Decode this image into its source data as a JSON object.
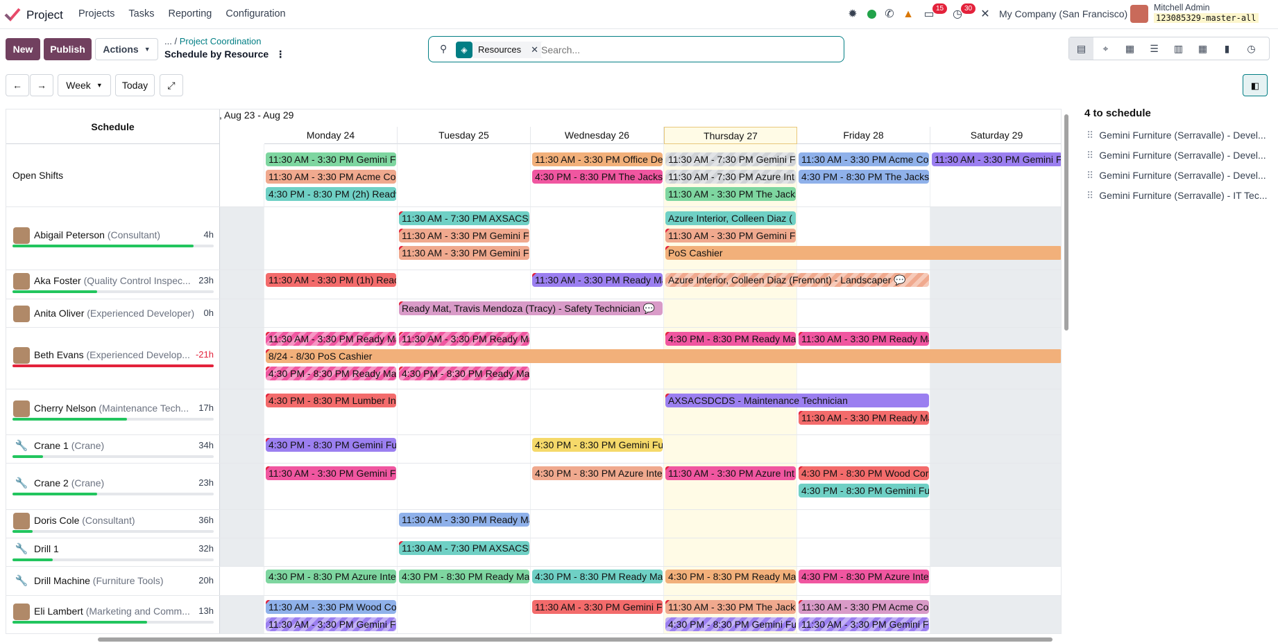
{
  "app": {
    "name": "Project"
  },
  "nav": [
    "Projects",
    "Tasks",
    "Reporting",
    "Configuration"
  ],
  "systray": {
    "messages_badge": "15",
    "activity_badge": "30",
    "company": "My Company (San Francisco)",
    "user": "Mitchell Admin",
    "db": "123085329-master-all"
  },
  "actions": {
    "new": "New",
    "publish": "Publish",
    "actions": "Actions"
  },
  "breadcrumb": {
    "ellipsis": "...",
    "parent": "Project Coordination",
    "current": "Schedule by Resource"
  },
  "search": {
    "facet": "Resources",
    "placeholder": "Search..."
  },
  "controls": {
    "scale": "Week",
    "today": "Today"
  },
  "range": "Aug 23 - Aug 29",
  "columns": {
    "schedule": "Schedule",
    "days": [
      "Monday 24",
      "Tuesday 25",
      "Wednesday 26",
      "Thursday 27",
      "Friday 28",
      "Saturday 29"
    ]
  },
  "rows": [
    {
      "name": "Open Shifts",
      "role": "",
      "hours": "",
      "progress": null
    },
    {
      "name": "Abigail Peterson",
      "role": "(Consultant)",
      "hours": "4h",
      "progress": 0.9
    },
    {
      "name": "Aka Foster",
      "role": "(Quality Control Inspec...",
      "hours": "23h",
      "progress": 0.42
    },
    {
      "name": "Anita Oliver",
      "role": "(Experienced Developer)",
      "hours": "0h",
      "progress": null
    },
    {
      "name": "Beth Evans",
      "role": "(Experienced Develop...",
      "hours": "-21h",
      "progress": 1.0
    },
    {
      "name": "Cherry Nelson",
      "role": "(Maintenance Tech...",
      "hours": "17h",
      "progress": 0.57
    },
    {
      "name": "Crane 1",
      "role": "(Crane)",
      "hours": "34h",
      "progress": 0.15
    },
    {
      "name": "Crane 2",
      "role": "(Crane)",
      "hours": "23h",
      "progress": 0.42
    },
    {
      "name": "Doris Cole",
      "role": "(Consultant)",
      "hours": "36h",
      "progress": 0.1
    },
    {
      "name": "Drill 1",
      "role": "",
      "hours": "32h",
      "progress": 0.2
    },
    {
      "name": "Drill Machine",
      "role": "(Furniture Tools)",
      "hours": "20h",
      "progress": null
    },
    {
      "name": "Eli Lambert",
      "role": "(Marketing and Comm...",
      "hours": "13h",
      "progress": 0.67
    }
  ],
  "shifts": [
    {
      "row": 0,
      "line": 0,
      "start": 0,
      "span": 1,
      "text": "11:30 AM - 3:30 PM Gemini Fu",
      "color": "#7ed6a0"
    },
    {
      "row": 0,
      "line": 1,
      "start": 0,
      "span": 1,
      "text": "11:30 AM - 3:30 PM Acme Co",
      "color": "#f0a98e"
    },
    {
      "row": 0,
      "line": 2,
      "start": 0,
      "span": 1,
      "text": "4:30 PM - 8:30 PM (2h) Ready",
      "color": "#6fd0c5"
    },
    {
      "row": 0,
      "line": 0,
      "start": 2,
      "span": 1,
      "text": "11:30 AM - 3:30 PM Office De",
      "color": "#f2b07a"
    },
    {
      "row": 0,
      "line": 1,
      "start": 2,
      "span": 1,
      "text": "4:30 PM - 8:30 PM The Jackso",
      "color": "#f056a0"
    },
    {
      "row": 0,
      "line": 0,
      "start": 3,
      "span": 1,
      "text": "11:30 AM - 7:30 PM Gemini Fu",
      "color": "#cfd2d6",
      "hatch": true
    },
    {
      "row": 0,
      "line": 1,
      "start": 3,
      "span": 1,
      "text": "11:30 AM - 7:30 PM Azure Int",
      "color": "#cfd2d6",
      "hatch": true
    },
    {
      "row": 0,
      "line": 2,
      "start": 3,
      "span": 1,
      "text": "11:30 AM - 3:30 PM The Jacks",
      "color": "#7ed6a0"
    },
    {
      "row": 0,
      "line": 0,
      "start": 4,
      "span": 1,
      "text": "11:30 AM - 3:30 PM Acme Co",
      "color": "#8fb1ea"
    },
    {
      "row": 0,
      "line": 1,
      "start": 4,
      "span": 1,
      "text": "4:30 PM - 8:30 PM The Jackso",
      "color": "#8fb1ea"
    },
    {
      "row": 0,
      "line": 0,
      "start": 5,
      "span": 1,
      "text": "11:30 AM - 3:30 PM Gemini Fu",
      "color": "#9b7ff0"
    },
    {
      "row": 1,
      "line": 0,
      "start": 1,
      "span": 1,
      "text": "11:30 AM - 7:30 PM AXSACSD",
      "color": "#6fd0c5",
      "flag": true
    },
    {
      "row": 1,
      "line": 1,
      "start": 1,
      "span": 1,
      "text": "11:30 AM - 3:30 PM Gemini Fu",
      "color": "#f0a98e",
      "flag": true
    },
    {
      "row": 1,
      "line": 2,
      "start": 1,
      "span": 1,
      "text": "11:30 AM - 3:30 PM Gemini Fu",
      "color": "#f0a98e",
      "flag": true
    },
    {
      "row": 1,
      "line": 0,
      "start": 3,
      "span": 1,
      "text": "Azure Interior, Colleen Diaz (",
      "color": "#6fd0c5"
    },
    {
      "row": 1,
      "line": 1,
      "start": 3,
      "span": 1,
      "text": "11:30 AM - 3:30 PM Gemini Fu",
      "color": "#f0a98e",
      "flag": true
    },
    {
      "row": 1,
      "line": 2,
      "start": 3,
      "span": 3,
      "text": "PoS Cashier",
      "color": "#f2b07a",
      "flag": true
    },
    {
      "row": 2,
      "line": 0,
      "start": 0,
      "span": 1,
      "text": "11:30 AM - 3:30 PM (1h) Reac",
      "color": "#f36b6b"
    },
    {
      "row": 2,
      "line": 0,
      "start": 2,
      "span": 1,
      "text": "11:30 AM - 3:30 PM Ready Ma",
      "color": "#9b7ff0",
      "flag": true
    },
    {
      "row": 2,
      "line": 0,
      "start": 3,
      "span": 2,
      "text": "Azure Interior, Colleen Diaz (Fremont) - Landscaper 💬",
      "color": "#f0a98e",
      "hatch": true
    },
    {
      "row": 3,
      "line": 0,
      "start": 1,
      "span": 2,
      "text": "Ready Mat, Travis Mendoza (Tracy) - Safety Technician 💬",
      "color": "#d99bc8",
      "flag": true
    },
    {
      "row": 4,
      "line": 0,
      "start": 0,
      "span": 1,
      "text": "11:30 AM - 3:30 PM Ready Ma",
      "color": "#f056a0",
      "hatch": true,
      "flag": true
    },
    {
      "row": 4,
      "line": 0,
      "start": 1,
      "span": 1,
      "text": "11:30 AM - 3:30 PM Ready Ma",
      "color": "#f056a0",
      "hatch": true,
      "flag": true
    },
    {
      "row": 4,
      "line": 0,
      "start": 3,
      "span": 1,
      "text": "4:30 PM - 8:30 PM Ready Mat",
      "color": "#f056a0",
      "flag": true
    },
    {
      "row": 4,
      "line": 0,
      "start": 4,
      "span": 1,
      "text": "11:30 AM - 3:30 PM Ready Ma",
      "color": "#f056a0",
      "flag": true
    },
    {
      "row": 4,
      "line": 1,
      "start": 0,
      "span": 6,
      "text": "8/24 - 8/30 PoS Cashier",
      "color": "#f2b07a",
      "flag": true
    },
    {
      "row": 4,
      "line": 2,
      "start": 0,
      "span": 1,
      "text": "4:30 PM - 8:30 PM Ready Mat",
      "color": "#f056a0",
      "hatch": true,
      "flag": true
    },
    {
      "row": 4,
      "line": 2,
      "start": 1,
      "span": 1,
      "text": "4:30 PM - 8:30 PM Ready Mat",
      "color": "#f056a0",
      "hatch": true,
      "flag": true
    },
    {
      "row": 5,
      "line": 0,
      "start": 0,
      "span": 1,
      "text": "4:30 PM - 8:30 PM Lumber In",
      "color": "#f36b6b",
      "flag": true
    },
    {
      "row": 5,
      "line": 0,
      "start": 3,
      "span": 2,
      "text": "AXSACSDCDS - Maintenance Technician",
      "color": "#9b7ff0",
      "flag": true
    },
    {
      "row": 5,
      "line": 1,
      "start": 4,
      "span": 1,
      "text": "11:30 AM - 3:30 PM Ready Ma",
      "color": "#f36b6b",
      "flag": true
    },
    {
      "row": 6,
      "line": 0,
      "start": 0,
      "span": 1,
      "text": "4:30 PM - 8:30 PM Gemini Fur",
      "color": "#9b7ff0",
      "flag": true
    },
    {
      "row": 6,
      "line": 0,
      "start": 2,
      "span": 1,
      "text": "4:30 PM - 8:30 PM Gemini Fur",
      "color": "#f5d96a"
    },
    {
      "row": 7,
      "line": 0,
      "start": 0,
      "span": 1,
      "text": "11:30 AM - 3:30 PM Gemini Fu",
      "color": "#f056a0",
      "flag": true
    },
    {
      "row": 7,
      "line": 0,
      "start": 2,
      "span": 1,
      "text": "4:30 PM - 8:30 PM Azure Inte",
      "color": "#f0a98e"
    },
    {
      "row": 7,
      "line": 0,
      "start": 3,
      "span": 1,
      "text": "11:30 AM - 3:30 PM Azure Int",
      "color": "#f056a0",
      "flag": true
    },
    {
      "row": 7,
      "line": 0,
      "start": 4,
      "span": 1,
      "text": "4:30 PM - 8:30 PM Wood Corr",
      "color": "#f36b6b",
      "flag": true
    },
    {
      "row": 7,
      "line": 1,
      "start": 4,
      "span": 1,
      "text": "4:30 PM - 8:30 PM Gemini Fur",
      "color": "#6fd0c5"
    },
    {
      "row": 8,
      "line": 0,
      "start": 1,
      "span": 1,
      "text": "11:30 AM - 3:30 PM Ready Ma",
      "color": "#8fb1ea"
    },
    {
      "row": 9,
      "line": 0,
      "start": 1,
      "span": 1,
      "text": "11:30 AM - 7:30 PM AXSACSD",
      "color": "#6fd0c5",
      "flag": true
    },
    {
      "row": 10,
      "line": 0,
      "start": 0,
      "span": 1,
      "text": "4:30 PM - 8:30 PM Azure Inte",
      "color": "#7ed6a0"
    },
    {
      "row": 10,
      "line": 0,
      "start": 1,
      "span": 1,
      "text": "4:30 PM - 8:30 PM Ready Mat",
      "color": "#7ed6a0"
    },
    {
      "row": 10,
      "line": 0,
      "start": 2,
      "span": 1,
      "text": "4:30 PM - 8:30 PM Ready Mat",
      "color": "#6fd0c5"
    },
    {
      "row": 10,
      "line": 0,
      "start": 3,
      "span": 1,
      "text": "4:30 PM - 8:30 PM Ready Mat",
      "color": "#f2b07a"
    },
    {
      "row": 10,
      "line": 0,
      "start": 4,
      "span": 1,
      "text": "4:30 PM - 8:30 PM Azure Inte",
      "color": "#f056a0"
    },
    {
      "row": 11,
      "line": 0,
      "start": 0,
      "span": 1,
      "text": "11:30 AM - 3:30 PM Wood Co",
      "color": "#8fb1ea",
      "flag": true
    },
    {
      "row": 11,
      "line": 1,
      "start": 0,
      "span": 1,
      "text": "11:30 AM - 3:30 PM Gemini Fu",
      "color": "#9b7ff0",
      "hatch": true
    },
    {
      "row": 11,
      "line": 0,
      "start": 2,
      "span": 1,
      "text": "11:30 AM - 3:30 PM Gemini Fu",
      "color": "#f36b6b"
    },
    {
      "row": 11,
      "line": 0,
      "start": 3,
      "span": 1,
      "text": "11:30 AM - 3:30 PM The Jack",
      "color": "#f0a98e",
      "flag": true
    },
    {
      "row": 11,
      "line": 1,
      "start": 3,
      "span": 1,
      "text": "4:30 PM - 8:30 PM Gemini Fur",
      "color": "#9b7ff0",
      "hatch": true
    },
    {
      "row": 11,
      "line": 0,
      "start": 4,
      "span": 1,
      "text": "11:30 AM - 3:30 PM Acme Co",
      "color": "#d99bc8",
      "flag": true
    },
    {
      "row": 11,
      "line": 1,
      "start": 4,
      "span": 1,
      "text": "11:30 AM - 3:30 PM Gemini Fu",
      "color": "#9b7ff0",
      "hatch": true
    }
  ],
  "to_schedule": {
    "title": "4 to schedule",
    "items": [
      "Gemini Furniture (Serravalle) - Devel...",
      "Gemini Furniture (Serravalle) - Devel...",
      "Gemini Furniture (Serravalle) - Devel...",
      "Gemini Furniture (Serravalle) - IT Tec..."
    ]
  }
}
